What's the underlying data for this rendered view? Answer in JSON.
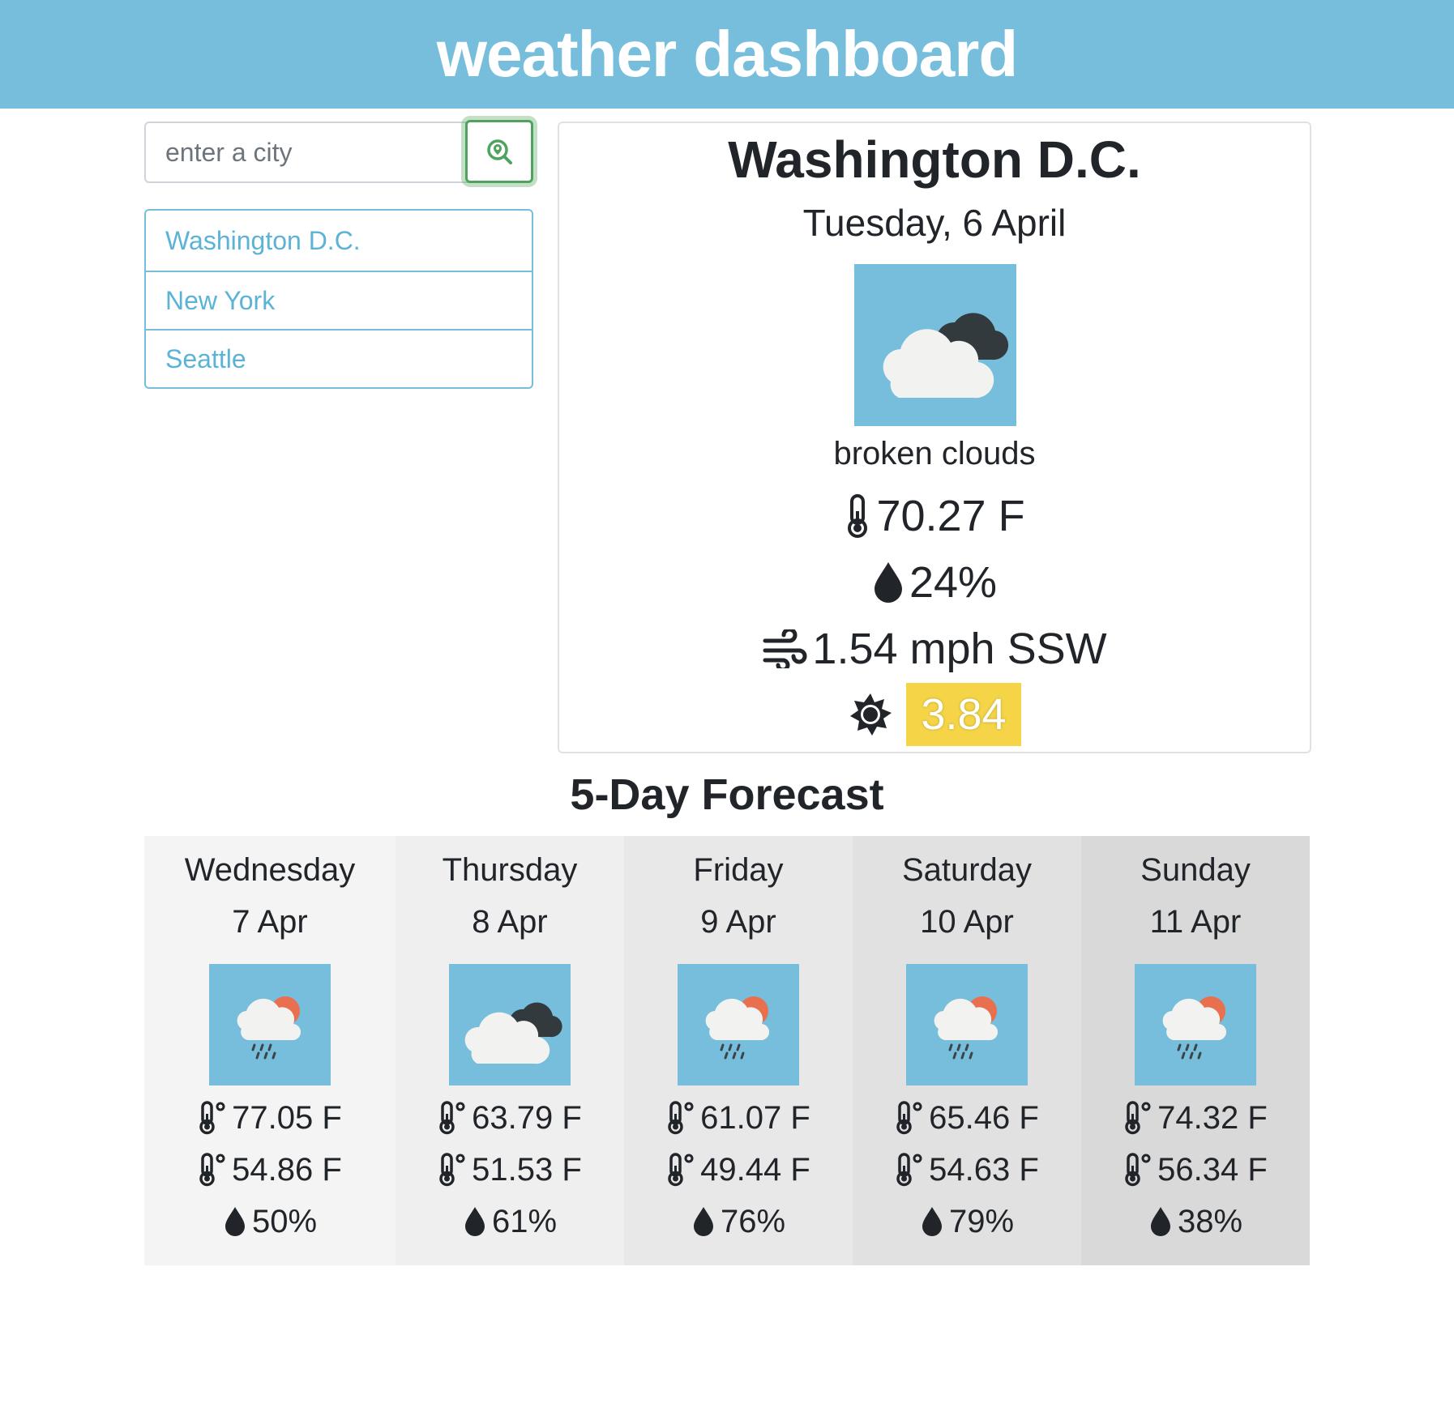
{
  "header": {
    "title": "weather dashboard",
    "background": "#76bedb"
  },
  "search": {
    "placeholder": "enter a city",
    "value": "",
    "button_icon": "search-location-icon",
    "button_color": "#4fa35f"
  },
  "saved_cities": [
    "Washington D.C.",
    "New York",
    "Seattle"
  ],
  "current": {
    "city": "Washington D.C.",
    "date": "Tuesday, 6 April",
    "icon": "broken-clouds-icon",
    "description": "broken clouds",
    "temperature": "70.27 F",
    "humidity": "24%",
    "wind": "1.54 mph SSW",
    "uv_index": "3.84",
    "uv_color": "#f5d547"
  },
  "forecast": {
    "title": "5-Day Forecast",
    "days": [
      {
        "day": "Wednesday",
        "date": "7 Apr",
        "icon": "rain-sun-icon",
        "high": "77.05 F",
        "low": "54.86 F",
        "humidity": "50%",
        "bg": "#f4f4f4"
      },
      {
        "day": "Thursday",
        "date": "8 Apr",
        "icon": "broken-clouds-icon",
        "high": "63.79 F",
        "low": "51.53 F",
        "humidity": "61%",
        "bg": "#efefef"
      },
      {
        "day": "Friday",
        "date": "9 Apr",
        "icon": "rain-sun-icon",
        "high": "61.07 F",
        "low": "49.44 F",
        "humidity": "76%",
        "bg": "#e8e8e8"
      },
      {
        "day": "Saturday",
        "date": "10 Apr",
        "icon": "rain-sun-icon",
        "high": "65.46 F",
        "low": "54.63 F",
        "humidity": "79%",
        "bg": "#e1e1e1"
      },
      {
        "day": "Sunday",
        "date": "11 Apr",
        "icon": "rain-sun-icon",
        "high": "74.32 F",
        "low": "56.34 F",
        "humidity": "38%",
        "bg": "#d9d9d9"
      }
    ]
  }
}
